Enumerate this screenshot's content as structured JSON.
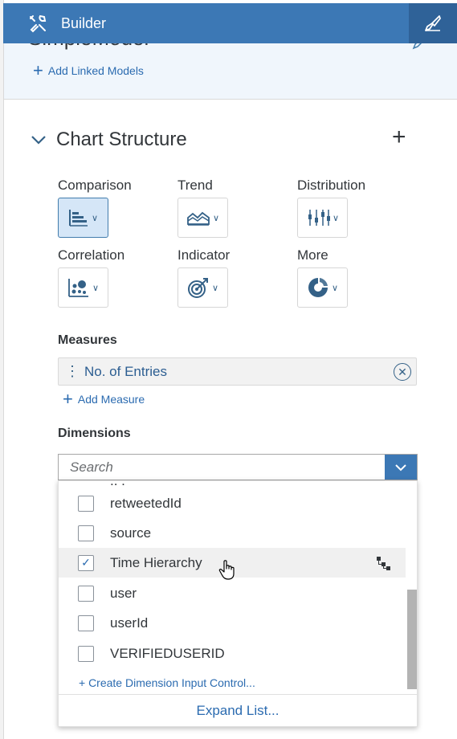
{
  "topbar": {
    "title": "Builder",
    "tools_icon": "tools-icon",
    "designer_icon": "paint-brush-icon"
  },
  "model": {
    "name": "SimpleModel",
    "add_linked_label": "Add Linked Models"
  },
  "chart_structure": {
    "title": "Chart Structure",
    "types": [
      {
        "label": "Comparison",
        "icon": "bar-chart-icon",
        "selected": true
      },
      {
        "label": "Trend",
        "icon": "area-chart-icon",
        "selected": false
      },
      {
        "label": "Distribution",
        "icon": "box-plot-icon",
        "selected": false
      },
      {
        "label": "Correlation",
        "icon": "scatter-chart-icon",
        "selected": false
      },
      {
        "label": "Indicator",
        "icon": "target-icon",
        "selected": false
      },
      {
        "label": "More",
        "icon": "donut-chart-icon",
        "selected": false
      }
    ]
  },
  "measures": {
    "label": "Measures",
    "items": [
      "No. of Entries"
    ],
    "add_label": "Add Measure"
  },
  "dimensions": {
    "label": "Dimensions",
    "search_placeholder": "Search",
    "list": [
      {
        "label": "retweetedId",
        "checked": false
      },
      {
        "label": "source",
        "checked": false
      },
      {
        "label": "Time Hierarchy",
        "checked": true,
        "hierarchy": true
      },
      {
        "label": "user",
        "checked": false
      },
      {
        "label": "userId",
        "checked": false
      },
      {
        "label": "VERIFIEDUSERID",
        "checked": false
      }
    ],
    "create_link": "+ Create Dimension Input Control...",
    "expand_label": "Expand List..."
  },
  "colors": {
    "shell_blue": "#3c78b5",
    "link_blue": "#2b6bb0",
    "selected_bg": "#d5e6f7"
  }
}
